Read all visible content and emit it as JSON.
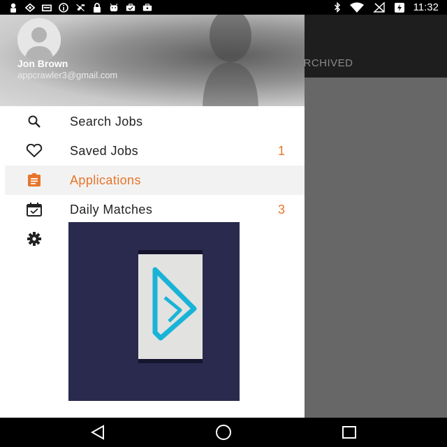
{
  "status_bar": {
    "time": "11:32",
    "left_icons": [
      "person-icon",
      "eye-icon",
      "storage-icon",
      "info-icon",
      "no-satellite-icon",
      "lock-icon",
      "android-icon",
      "briefcase-check-icon",
      "briefcase-icon"
    ],
    "right_icons": [
      "bluetooth-icon",
      "wifi-icon",
      "no-signal-icon",
      "battery-charging-icon"
    ]
  },
  "background_app": {
    "tab_label": "ARCHIVED"
  },
  "drawer": {
    "user": {
      "name": "Jon Brown",
      "email": "appcrawler3@gmail.com"
    },
    "items": [
      {
        "label": "Search Jobs",
        "icon": "search-icon",
        "count": ""
      },
      {
        "label": "Saved Jobs",
        "icon": "heart-icon",
        "count": "1"
      },
      {
        "label": "Applications",
        "icon": "clipboard-icon",
        "count": "",
        "active": true
      },
      {
        "label": "Daily Matches",
        "icon": "calendar-check-icon",
        "count": "3"
      },
      {
        "label": "",
        "icon": "gear-icon",
        "count": ""
      }
    ]
  },
  "nav_bar": {
    "buttons": [
      "back-icon",
      "home-icon",
      "recents-icon"
    ]
  },
  "colors": {
    "accent": "#e8742a",
    "active_bg": "#f2f2f2",
    "scrim": "#676767",
    "promo_bg": "#2a2a4f",
    "logo": "#1ab3d8"
  }
}
